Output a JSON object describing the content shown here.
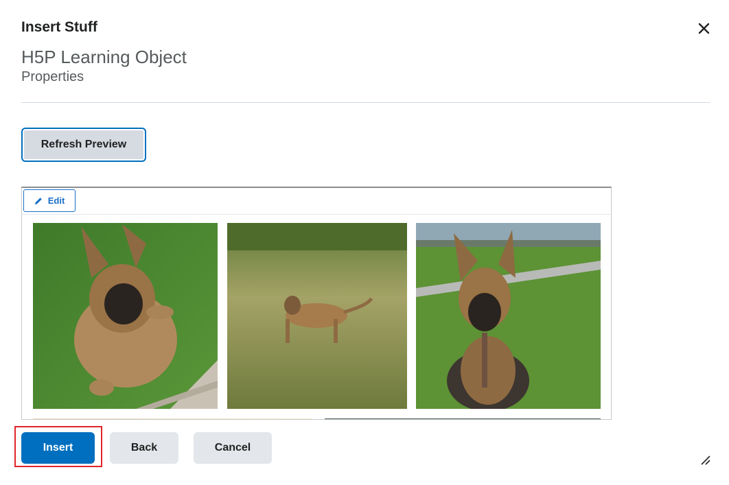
{
  "dialog": {
    "title": "Insert Stuff",
    "subtitle": "H5P Learning Object",
    "section": "Properties"
  },
  "toolbar": {
    "refresh_label": "Refresh Preview"
  },
  "preview": {
    "edit_label": "Edit",
    "images": [
      "dog-photo-1",
      "dog-photo-2",
      "dog-photo-3",
      "dog-photo-4",
      "dog-photo-5"
    ]
  },
  "footer": {
    "insert_label": "Insert",
    "back_label": "Back",
    "cancel_label": "Cancel"
  },
  "colors": {
    "primary": "#006fbf",
    "highlight": "#e0242a",
    "secondary_button": "#e3e6ea"
  },
  "icons": {
    "close": "close-icon",
    "edit": "pencil-icon",
    "resize": "resize-grip-icon"
  }
}
